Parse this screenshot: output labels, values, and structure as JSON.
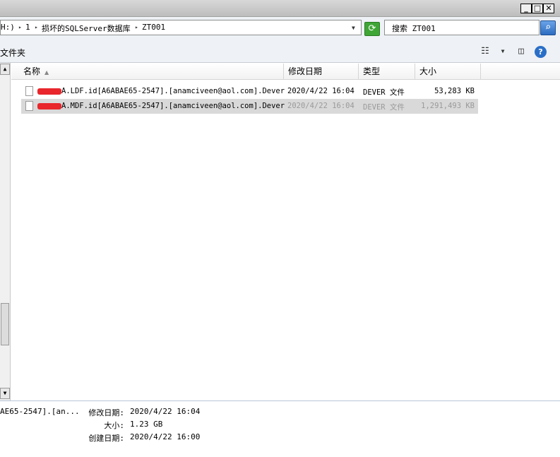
{
  "address": {
    "crumbs": [
      "H:)",
      "1",
      "损坏的SQLServer数据库",
      "ZT001"
    ]
  },
  "search": {
    "text": "搜索 ZT001"
  },
  "toolbar": {
    "folder_label": "文件夹"
  },
  "columns": [
    "名称",
    "修改日期",
    "类型",
    "大小"
  ],
  "files": [
    {
      "name": "A.LDF.id[A6ABAE65-2547].[anamciveen@aol.com].Dever",
      "modified": "2020/4/22 16:04",
      "type": "DEVER 文件",
      "size": "53,283 KB",
      "selected": false
    },
    {
      "name": "A.MDF.id[A6ABAE65-2547].[anamciveen@aol.com].Dever",
      "modified": "2020/4/22 16:04",
      "type": "DEVER 文件",
      "size": "1,291,493 KB",
      "selected": true
    }
  ],
  "details": {
    "name_fragment": "AE65-2547].[an...",
    "modified_label": "修改日期:",
    "modified_value": "2020/4/22 16:04",
    "size_label": "大小:",
    "size_value": "1.23 GB",
    "created_label": "创建日期:",
    "created_value": "2020/4/22 16:00"
  },
  "icons": {
    "refresh": "refresh-icon",
    "search": "search-icon",
    "views": "view-list-icon",
    "preview": "preview-pane-icon",
    "help": "help-icon"
  },
  "colors": {
    "selection": "#d9d9d9",
    "redaction": "#e8262b",
    "refresh_green": "#3fa635"
  }
}
